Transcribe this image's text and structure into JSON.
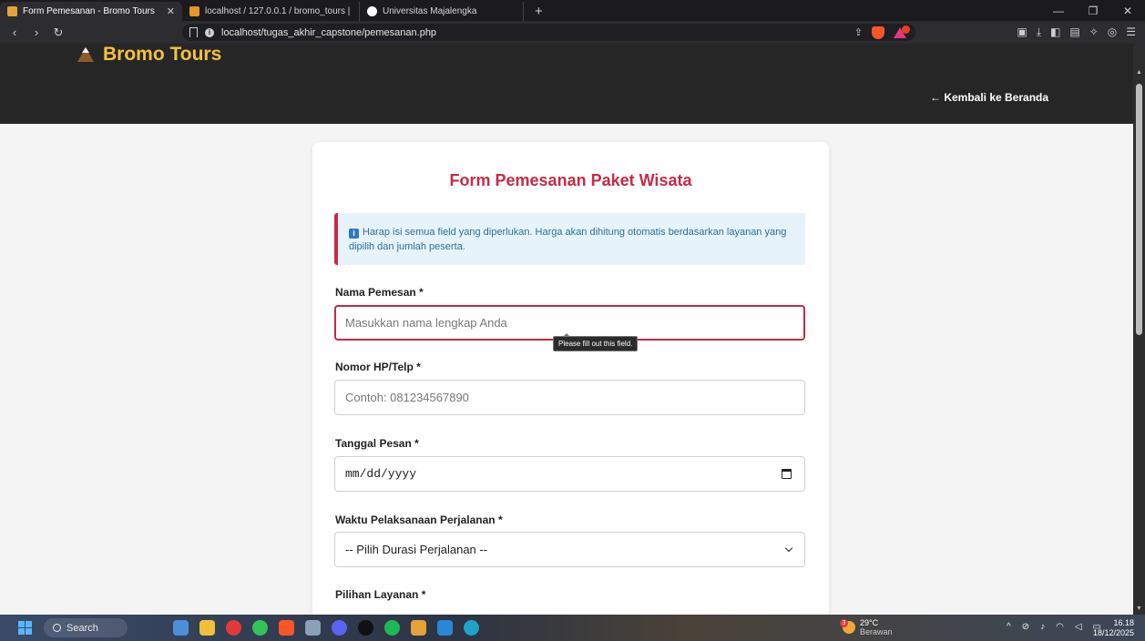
{
  "browser": {
    "tabs": [
      {
        "label": "Form Pemesanan - Bromo Tours",
        "active": true,
        "color": "#e4a23a"
      },
      {
        "label": "localhost / 127.0.0.1 / bromo_tours |",
        "active": false,
        "color": "#e8952a"
      },
      {
        "label": "Universitas Majalengka",
        "active": false,
        "color": "#ffffff"
      }
    ],
    "new_tab": "+",
    "url": "localhost/tugas_akhir_capstone/pemesanan.php"
  },
  "site": {
    "brand": "Bromo Tours",
    "back_link": "← Kembali ke Beranda",
    "brand_color": "#f4c142"
  },
  "form": {
    "title": "Form Pemesanan Paket Wisata",
    "alert": "Harap isi semua field yang diperlukan. Harga akan dihitung otomatis berdasarkan layanan yang dipilih dan jumlah peserta.",
    "fields": {
      "nama": {
        "label": "Nama Pemesan *",
        "placeholder": "Masukkan nama lengkap Anda"
      },
      "hp": {
        "label": "Nomor HP/Telp *",
        "placeholder": "Contoh: 081234567890"
      },
      "tanggal": {
        "label": "Tanggal Pesan *",
        "value": "mm/dd/yyyy"
      },
      "waktu": {
        "label": "Waktu Pelaksanaan Perjalanan *",
        "value": "-- Pilih Durasi Perjalanan --"
      },
      "layanan": {
        "label": "Pilihan Layanan *"
      }
    },
    "validation_tooltip": "Please fill out this field.",
    "accent_color": "#c62a46"
  },
  "taskbar": {
    "search": "Search",
    "weather_temp": "29°C",
    "weather_desc": "Berawan",
    "weather_badge": "3",
    "time": "16.18",
    "date": "18/12/2025"
  }
}
